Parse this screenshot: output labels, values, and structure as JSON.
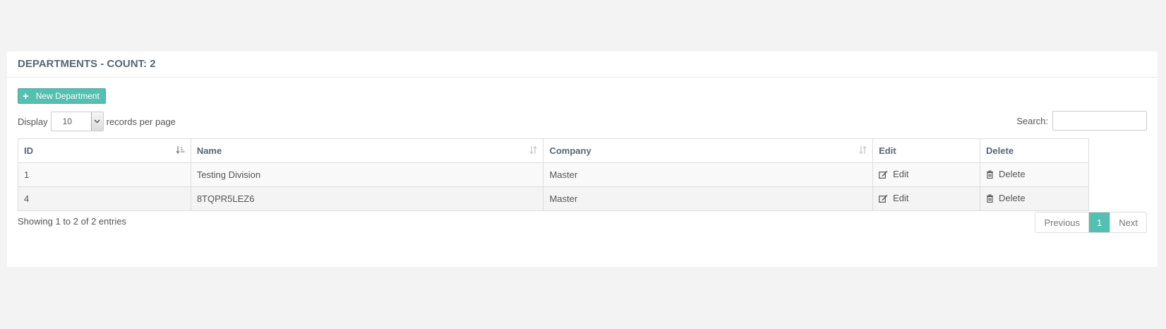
{
  "panel": {
    "title": "DEPARTMENTS - COUNT: 2"
  },
  "toolbar": {
    "new_label": "New Department",
    "display_label": "Display",
    "page_size": "10",
    "records_label": "records per page",
    "search_label": "Search:",
    "search_value": ""
  },
  "table": {
    "headers": {
      "id": "ID",
      "name": "Name",
      "company": "Company",
      "edit": "Edit",
      "delete": "Delete"
    },
    "rows": [
      {
        "id": "1",
        "name": "Testing Division",
        "company": "Master",
        "edit": "Edit",
        "delete": "Delete"
      },
      {
        "id": "4",
        "name": "8TQPR5LEZ6",
        "company": "Master",
        "edit": "Edit",
        "delete": "Delete"
      }
    ]
  },
  "footer": {
    "info": "Showing 1 to 2 of 2 entries",
    "prev": "Previous",
    "page": "1",
    "next": "Next"
  },
  "colors": {
    "accent": "#55bfb0"
  }
}
